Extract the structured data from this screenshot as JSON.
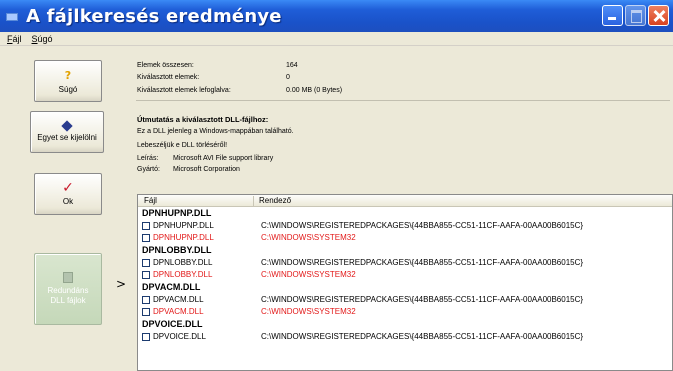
{
  "window": {
    "title": "A fájlkeresés eredménye"
  },
  "menu": [
    {
      "pre": "",
      "acc": "F",
      "post": "ájl"
    },
    {
      "pre": "",
      "acc": "S",
      "post": "úgó"
    }
  ],
  "buttons": {
    "help": "Súgó",
    "deselect": "Egyet se kijelölni",
    "ok": "Ok",
    "redundant_line1": "Redundáns",
    "redundant_line2": "DLL fájlok",
    "arrow": ">"
  },
  "stats": {
    "total_label": "Elemek összesen:",
    "total_value": "164",
    "selected_label": "Kiválasztott elemek:",
    "selected_value": "0",
    "size_label": "Kiválasztott elemek lefoglalva:",
    "size_value": "0.00 MB (0 Bytes)"
  },
  "guide": {
    "heading": "Útmutatás a kiválasztott DLL-fájlhoz:",
    "line1": "Ez a DLL jelenleg a Windows-mappában található.",
    "line2": "Lebeszéljük e DLL törléséről!",
    "desc_label": "Leírás:",
    "desc_value": "Microsoft AVI File support library",
    "maker_label": "Gyártó:",
    "maker_value": "Microsoft Corporation"
  },
  "list": {
    "col_file": "Fájl",
    "col_folder": "Rendező",
    "groups": [
      {
        "name": "DPNHUPNP.DLL",
        "file1": "DPNHUPNP.DLL",
        "path1": "C:\\WINDOWS\\REGISTEREDPACKAGES\\{44BBA855-CC51-11CF-AAFA-00AA00B6015C}",
        "file2": "DPNHUPNP.DLL",
        "path2": "C:\\WINDOWS\\SYSTEM32"
      },
      {
        "name": "DPNLOBBY.DLL",
        "file1": "DPNLOBBY.DLL",
        "path1": "C:\\WINDOWS\\REGISTEREDPACKAGES\\{44BBA855-CC51-11CF-AAFA-00AA00B6015C}",
        "file2": "DPNLOBBY.DLL",
        "path2": "C:\\WINDOWS\\SYSTEM32"
      },
      {
        "name": "DPVACM.DLL",
        "file1": "DPVACM.DLL",
        "path1": "C:\\WINDOWS\\REGISTEREDPACKAGES\\{44BBA855-CC51-11CF-AAFA-00AA00B6015C}",
        "file2": "DPVACM.DLL",
        "path2": "C:\\WINDOWS\\SYSTEM32"
      },
      {
        "name": "DPVOICE.DLL",
        "file1": "DPVOICE.DLL",
        "path1": "C:\\WINDOWS\\REGISTEREDPACKAGES\\{44BBA855-CC51-11CF-AAFA-00AA00B6015C}"
      }
    ]
  },
  "colors": {
    "titlebar": "#1f5ed8",
    "duplicate": "#e21818"
  }
}
